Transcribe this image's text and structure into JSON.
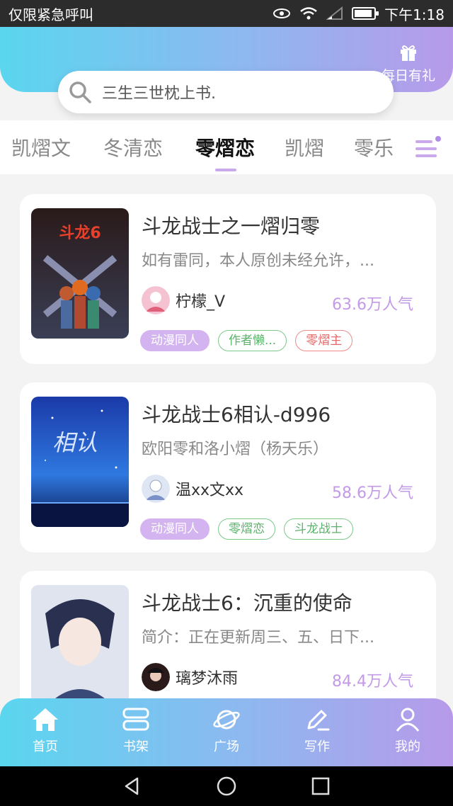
{
  "status_bar": {
    "carrier": "仅限紧急呼叫",
    "time": "下午1:18"
  },
  "header": {
    "gift_label": "每日有礼",
    "search": {
      "text": "三生三世枕上书."
    }
  },
  "tabs": [
    {
      "label": "凯熠文",
      "active": false
    },
    {
      "label": "冬清恋",
      "active": false
    },
    {
      "label": "零熠恋",
      "active": true
    },
    {
      "label": "凯熠",
      "active": false
    },
    {
      "label": "零乐",
      "active": false
    }
  ],
  "cards": [
    {
      "title": "斗龙战士之一熠归零",
      "desc": "如有雷同，本人原创未经允许，...",
      "author": "柠檬_V",
      "popularity": "63.6万人气",
      "tags": [
        {
          "label": "动漫同人",
          "style": "fill"
        },
        {
          "label": "作者懒...",
          "style": "green"
        },
        {
          "label": "零熠主",
          "style": "red"
        }
      ]
    },
    {
      "title": "斗龙战士6相认-d996",
      "desc": "欧阳零和洛小熠（杨天乐）",
      "author": "温xx文xx",
      "popularity": "58.6万人气",
      "tags": [
        {
          "label": "动漫同人",
          "style": "fill"
        },
        {
          "label": "零熠恋",
          "style": "green"
        },
        {
          "label": "斗龙战士",
          "style": "green"
        }
      ]
    },
    {
      "title": "斗龙战士6：沉重的使命",
      "desc": "简介：正在更新周三、五、日下...",
      "author": "璃梦沐雨",
      "popularity": "84.4万人气",
      "tags": []
    }
  ],
  "bottom_nav": [
    {
      "label": "首页",
      "icon": "home-icon"
    },
    {
      "label": "书架",
      "icon": "bookshelf-icon"
    },
    {
      "label": "广场",
      "icon": "planet-icon"
    },
    {
      "label": "写作",
      "icon": "pen-icon"
    },
    {
      "label": "我的",
      "icon": "user-icon"
    }
  ],
  "colors": {
    "gradient_start": "#5ad6ef",
    "gradient_end": "#b79ae9",
    "accent_purple": "#c39ae8",
    "tag_fill": "#d3b3f0",
    "tag_green": "#59b36a",
    "tag_red": "#e36b6b"
  }
}
